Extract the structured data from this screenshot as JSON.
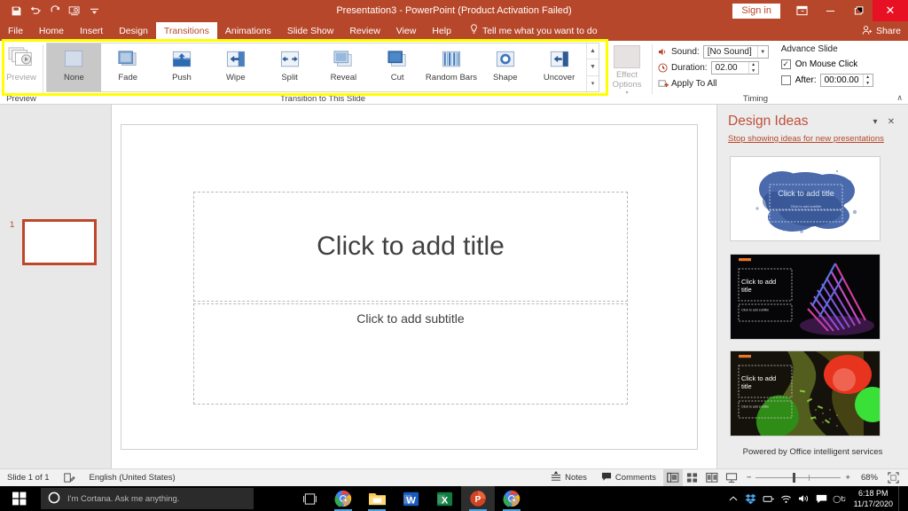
{
  "titlebar": {
    "app_title": "Presentation3  -  PowerPoint (Product Activation Failed)",
    "signin_label": "Sign in",
    "quick_access": [
      {
        "name": "save-icon",
        "label": "Save"
      },
      {
        "name": "undo-icon",
        "label": "Undo"
      },
      {
        "name": "redo-icon",
        "label": "Redo"
      },
      {
        "name": "start-presentation-icon",
        "label": "Start From Beginning"
      },
      {
        "name": "customize-qat-icon",
        "label": "Customize Quick Access Toolbar"
      }
    ],
    "window_controls": {
      "ribbon_display": "Ribbon Display Options",
      "minimize": "—",
      "maximize": "❐",
      "close": "✕"
    },
    "accent_color": "#b7472a",
    "close_color": "#e81123"
  },
  "tabs": [
    {
      "label": "File",
      "active": false
    },
    {
      "label": "Home",
      "active": false
    },
    {
      "label": "Insert",
      "active": false
    },
    {
      "label": "Design",
      "active": false
    },
    {
      "label": "Transitions",
      "active": true
    },
    {
      "label": "Animations",
      "active": false
    },
    {
      "label": "Slide Show",
      "active": false
    },
    {
      "label": "Review",
      "active": false
    },
    {
      "label": "View",
      "active": false
    },
    {
      "label": "Help",
      "active": false
    }
  ],
  "tellme": {
    "label": "Tell me what you want to do",
    "icon": "lightbulb-icon"
  },
  "share": {
    "label": "Share",
    "icon": "share-person-icon"
  },
  "ribbon": {
    "preview_group": {
      "label": "Preview",
      "button_label": "Preview"
    },
    "transition_group": {
      "label": "Transition to This Slide",
      "items": [
        {
          "label": "None",
          "icon": "none-transition-icon",
          "selected": true
        },
        {
          "label": "Fade",
          "icon": "fade-transition-icon",
          "selected": false
        },
        {
          "label": "Push",
          "icon": "push-transition-icon",
          "selected": false
        },
        {
          "label": "Wipe",
          "icon": "wipe-transition-icon",
          "selected": false
        },
        {
          "label": "Split",
          "icon": "split-transition-icon",
          "selected": false
        },
        {
          "label": "Reveal",
          "icon": "reveal-transition-icon",
          "selected": false
        },
        {
          "label": "Cut",
          "icon": "cut-transition-icon",
          "selected": false
        },
        {
          "label": "Random Bars",
          "icon": "random-bars-transition-icon",
          "selected": false
        },
        {
          "label": "Shape",
          "icon": "shape-transition-icon",
          "selected": false
        },
        {
          "label": "Uncover",
          "icon": "uncover-transition-icon",
          "selected": false
        }
      ]
    },
    "effect_options": {
      "label": "Effect Options"
    },
    "timing_group": {
      "label": "Timing",
      "sound_label": "Sound:",
      "sound_value": "[No Sound]",
      "duration_label": "Duration:",
      "duration_value": "02.00",
      "apply_to_all_label": "Apply To All",
      "advance_title": "Advance Slide",
      "on_mouse_click_label": "On Mouse Click",
      "on_mouse_click_checked": "✓",
      "after_label": "After:",
      "after_value": "00:00.00"
    },
    "collapse_label": "∧"
  },
  "thumbnails": {
    "slide_number": "1"
  },
  "slide": {
    "title_placeholder": "Click to add title",
    "subtitle_placeholder": "Click to add subtitle"
  },
  "design_ideas": {
    "title": "Design Ideas",
    "stop_link": "Stop showing ideas for new presentations",
    "footer": "Powered by Office intelligent services",
    "chevron": "▾",
    "close": "✕",
    "cards": [
      {
        "name": "design-idea-watercolor",
        "title_text": "Click to add title",
        "subtitle_text": "Click to add subtitle"
      },
      {
        "name": "design-idea-neon",
        "title_text": "Click to add title",
        "subtitle_text": "Click to add subtitle"
      },
      {
        "name": "design-idea-organic",
        "title_text": "Click to add title",
        "subtitle_text": "Click to add subtitle"
      }
    ]
  },
  "statusbar": {
    "slide_count": "Slide 1 of 1",
    "accessibility_icon": "accessibility-checker-icon",
    "language": "English (United States)",
    "notes_label": "Notes",
    "comments_label": "Comments",
    "views": [
      {
        "name": "normal-view-button",
        "active": true
      },
      {
        "name": "slide-sorter-view-button",
        "active": false
      },
      {
        "name": "reading-view-button",
        "active": false
      },
      {
        "name": "slide-show-view-button",
        "active": false
      }
    ],
    "zoom_out": "−",
    "zoom_in": "+",
    "zoom_level": "68%",
    "fit_slide": "fit-to-window-icon"
  },
  "taskbar": {
    "start_label": "Start",
    "cortana_placeholder": "I'm Cortana. Ask me anything.",
    "task_view": "task-view-icon",
    "apps": [
      {
        "name": "chrome-taskbar-icon",
        "running": true
      },
      {
        "name": "file-explorer-taskbar-icon",
        "running": true
      },
      {
        "name": "word-taskbar-icon",
        "running": false
      },
      {
        "name": "excel-taskbar-icon",
        "running": false
      },
      {
        "name": "powerpoint-taskbar-icon",
        "running": true,
        "active": true
      },
      {
        "name": "chrome-second-taskbar-icon",
        "running": true
      }
    ],
    "tray": [
      "show-hidden-icons",
      "dropbox-icon",
      "ink-workspace-icon",
      "wifi-icon",
      "volume-icon",
      "action-center-icon",
      "input-indicator-icon"
    ],
    "time": "6:18 PM",
    "date": "11/17/2020"
  }
}
